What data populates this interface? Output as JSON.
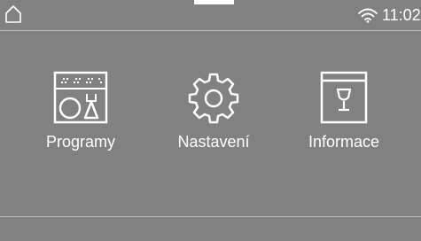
{
  "status_bar": {
    "home_icon": "home-icon",
    "wifi_icon": "wifi-icon",
    "time": "11:02"
  },
  "menu": {
    "items": [
      {
        "label": "Programy",
        "icon": "dishes-icon"
      },
      {
        "label": "Nastavení",
        "icon": "gear-icon"
      },
      {
        "label": "Informace",
        "icon": "wine-glass-icon"
      }
    ]
  },
  "colors": {
    "background": "#818181",
    "foreground": "#ffffff",
    "divider": "#bdbdbd"
  }
}
